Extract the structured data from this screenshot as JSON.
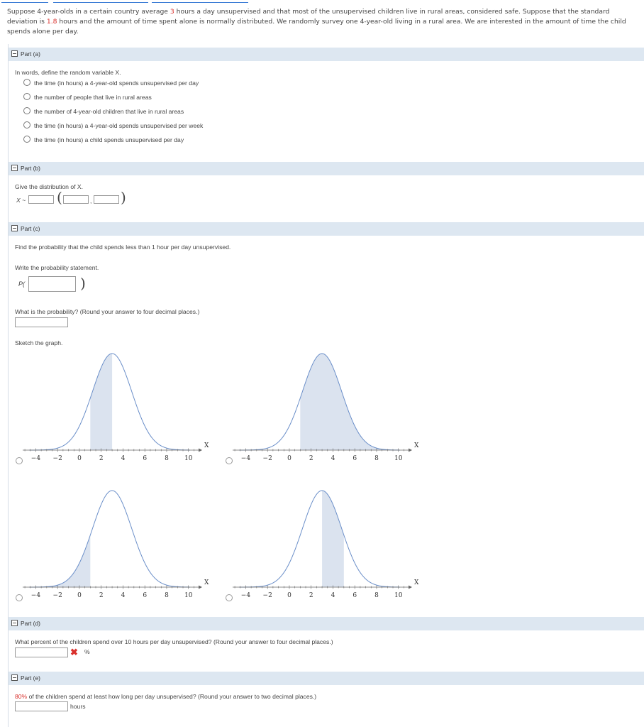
{
  "intro": {
    "p1": "Suppose 4-year-olds in a certain country average ",
    "mean": "3",
    "p2": " hours a day unsupervised and that most of the unsupervised children live in rural areas, considered safe. Suppose that the standard deviation is ",
    "sd": "1.8",
    "p3": " hours and the amount of time spent alone is normally distributed. We randomly survey one 4-year-old living in a rural area. We are interested in the amount of time the child spends alone per day."
  },
  "part_a": {
    "header": "Part (a)",
    "question": "In words, define the random variable X.",
    "options": [
      "the time (in hours) a 4-year-old spends unsupervised per day",
      "the number of people that live in rural areas",
      "the number of 4-year-old children that live in rural areas",
      "the time (in hours) a 4-year-old spends unsupervised per week",
      "the time (in hours) a child spends unsupervised per day"
    ]
  },
  "part_b": {
    "header": "Part (b)",
    "question": "Give the distribution of X.",
    "x_label": "X ~",
    "comma": ","
  },
  "part_c": {
    "header": "Part (c)",
    "question": "Find the probability that the child spends less than 1 hour per day unsupervised.",
    "statement_prompt": "Write the probability statement.",
    "p_label": "P(",
    "close_paren": ")",
    "prob_prompt": "What is the probability? (Round your answer to four decimal places.)",
    "sketch_prompt": "Sketch the graph.",
    "graphs": [
      {
        "shade_from": 1,
        "shade_to": 3
      },
      {
        "shade_from": 1,
        "shade_to": 10
      },
      {
        "shade_from": -6,
        "shade_to": 1
      },
      {
        "shade_from": 3,
        "shade_to": 5
      }
    ],
    "axis": {
      "ticks": [
        "-4",
        "-2",
        "0",
        "2",
        "4",
        "6",
        "8",
        "10"
      ],
      "xlabel": "X",
      "mean": 3,
      "sd": 1.8
    }
  },
  "part_d": {
    "header": "Part (d)",
    "question": "What percent of the children spend over 10 hours per day unsupervised? (Round your answer to four decimal places.)",
    "unit": "%",
    "status_icon": "incorrect-x-icon"
  },
  "part_e": {
    "header": "Part (e)",
    "pct": "80%",
    "question": " of the children spend at least how long per day unsupervised? (Round your answer to two decimal places.)",
    "unit": "hours"
  },
  "colors": {
    "header_bg": "#dde7f1",
    "curve": "#6b8fc9",
    "shade": "#dbe3ef",
    "accent_red": "#d9302c"
  }
}
